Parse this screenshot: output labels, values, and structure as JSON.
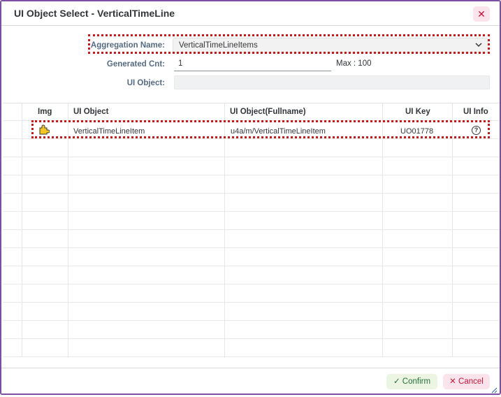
{
  "dialog": {
    "title": "UI Object Select - VerticalTimeLine",
    "close_glyph": "✕"
  },
  "form": {
    "aggregation_label": "Aggregation Name:",
    "aggregation_value": "VerticalTimeLineItems",
    "generated_cnt_label": "Generated Cnt:",
    "generated_cnt_value": "1",
    "max_text": "Max : 100",
    "ui_object_label": "UI Object:",
    "ui_object_value": ""
  },
  "table": {
    "columns": [
      "Img",
      "UI Object",
      "UI Object(Fullname)",
      "UI Key",
      "UI Info"
    ],
    "rows": [
      {
        "img_icon": "puzzle-piece-icon",
        "ui_object": "VerticalTimeLineItem",
        "fullname": "u4a/m/VerticalTimeLineItem",
        "ui_key": "UO01778",
        "info_icon": "help-circle-icon",
        "info_glyph": "?"
      }
    ]
  },
  "footer": {
    "confirm_label": "Confirm",
    "confirm_glyph": "✓",
    "cancel_label": "Cancel",
    "cancel_glyph": "✕"
  },
  "colors": {
    "border": "#7b4fa3",
    "highlight": "#c11b1b",
    "confirm_bg": "#ebf5e1",
    "cancel_bg": "#fbe3ec"
  }
}
